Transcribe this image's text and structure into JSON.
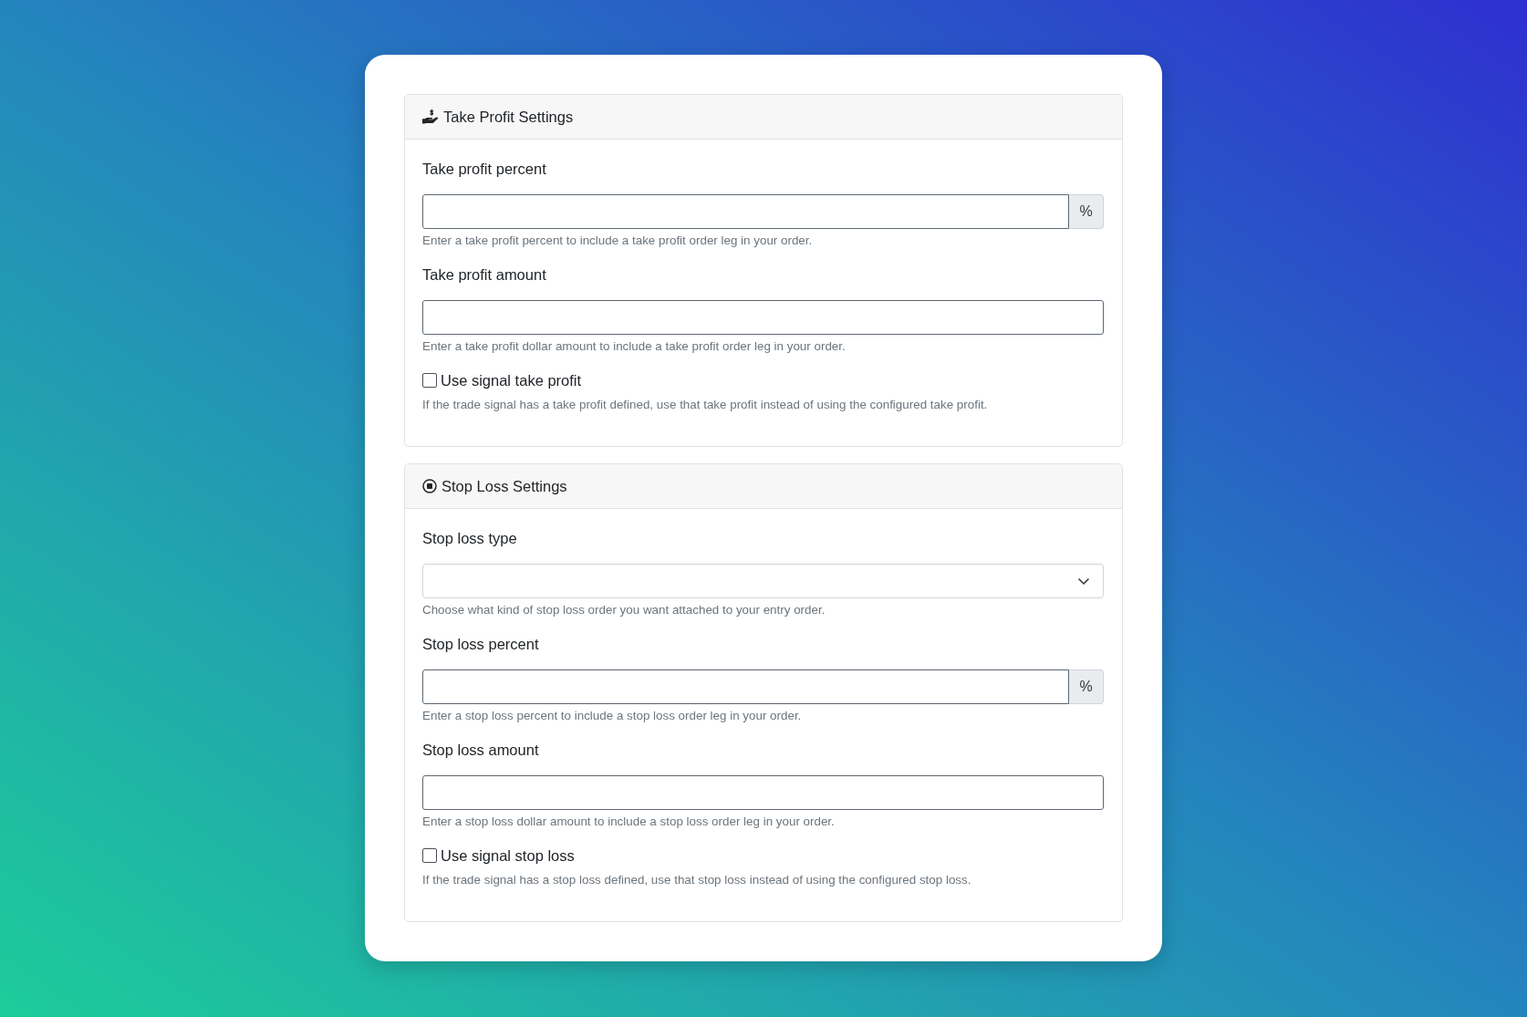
{
  "sections": [
    {
      "title": "Take Profit Settings",
      "fields": [
        {
          "kind": "input",
          "label": "Take profit percent",
          "addon": "%",
          "help": "Enter a take profit percent to include a take profit order leg in your order."
        },
        {
          "kind": "input",
          "label": "Take profit amount",
          "help": "Enter a take profit dollar amount to include a take profit order leg in your order."
        },
        {
          "kind": "checkbox",
          "label": "Use signal take profit",
          "checked": false,
          "help": "If the trade signal has a take profit defined, use that take profit instead of using the configured take profit."
        }
      ]
    },
    {
      "title": "Stop Loss Settings",
      "fields": [
        {
          "kind": "select",
          "label": "Stop loss type",
          "help": "Choose what kind of stop loss order you want attached to your entry order."
        },
        {
          "kind": "input",
          "label": "Stop loss percent",
          "addon": "%",
          "help": "Enter a stop loss percent to include a stop loss order leg in your order."
        },
        {
          "kind": "input",
          "label": "Stop loss amount",
          "help": "Enter a stop loss dollar amount to include a stop loss order leg in your order."
        },
        {
          "kind": "checkbox",
          "label": "Use signal stop loss",
          "checked": false,
          "help": "If the trade signal has a stop loss defined, use that stop loss instead of using the configured stop loss."
        }
      ]
    }
  ]
}
